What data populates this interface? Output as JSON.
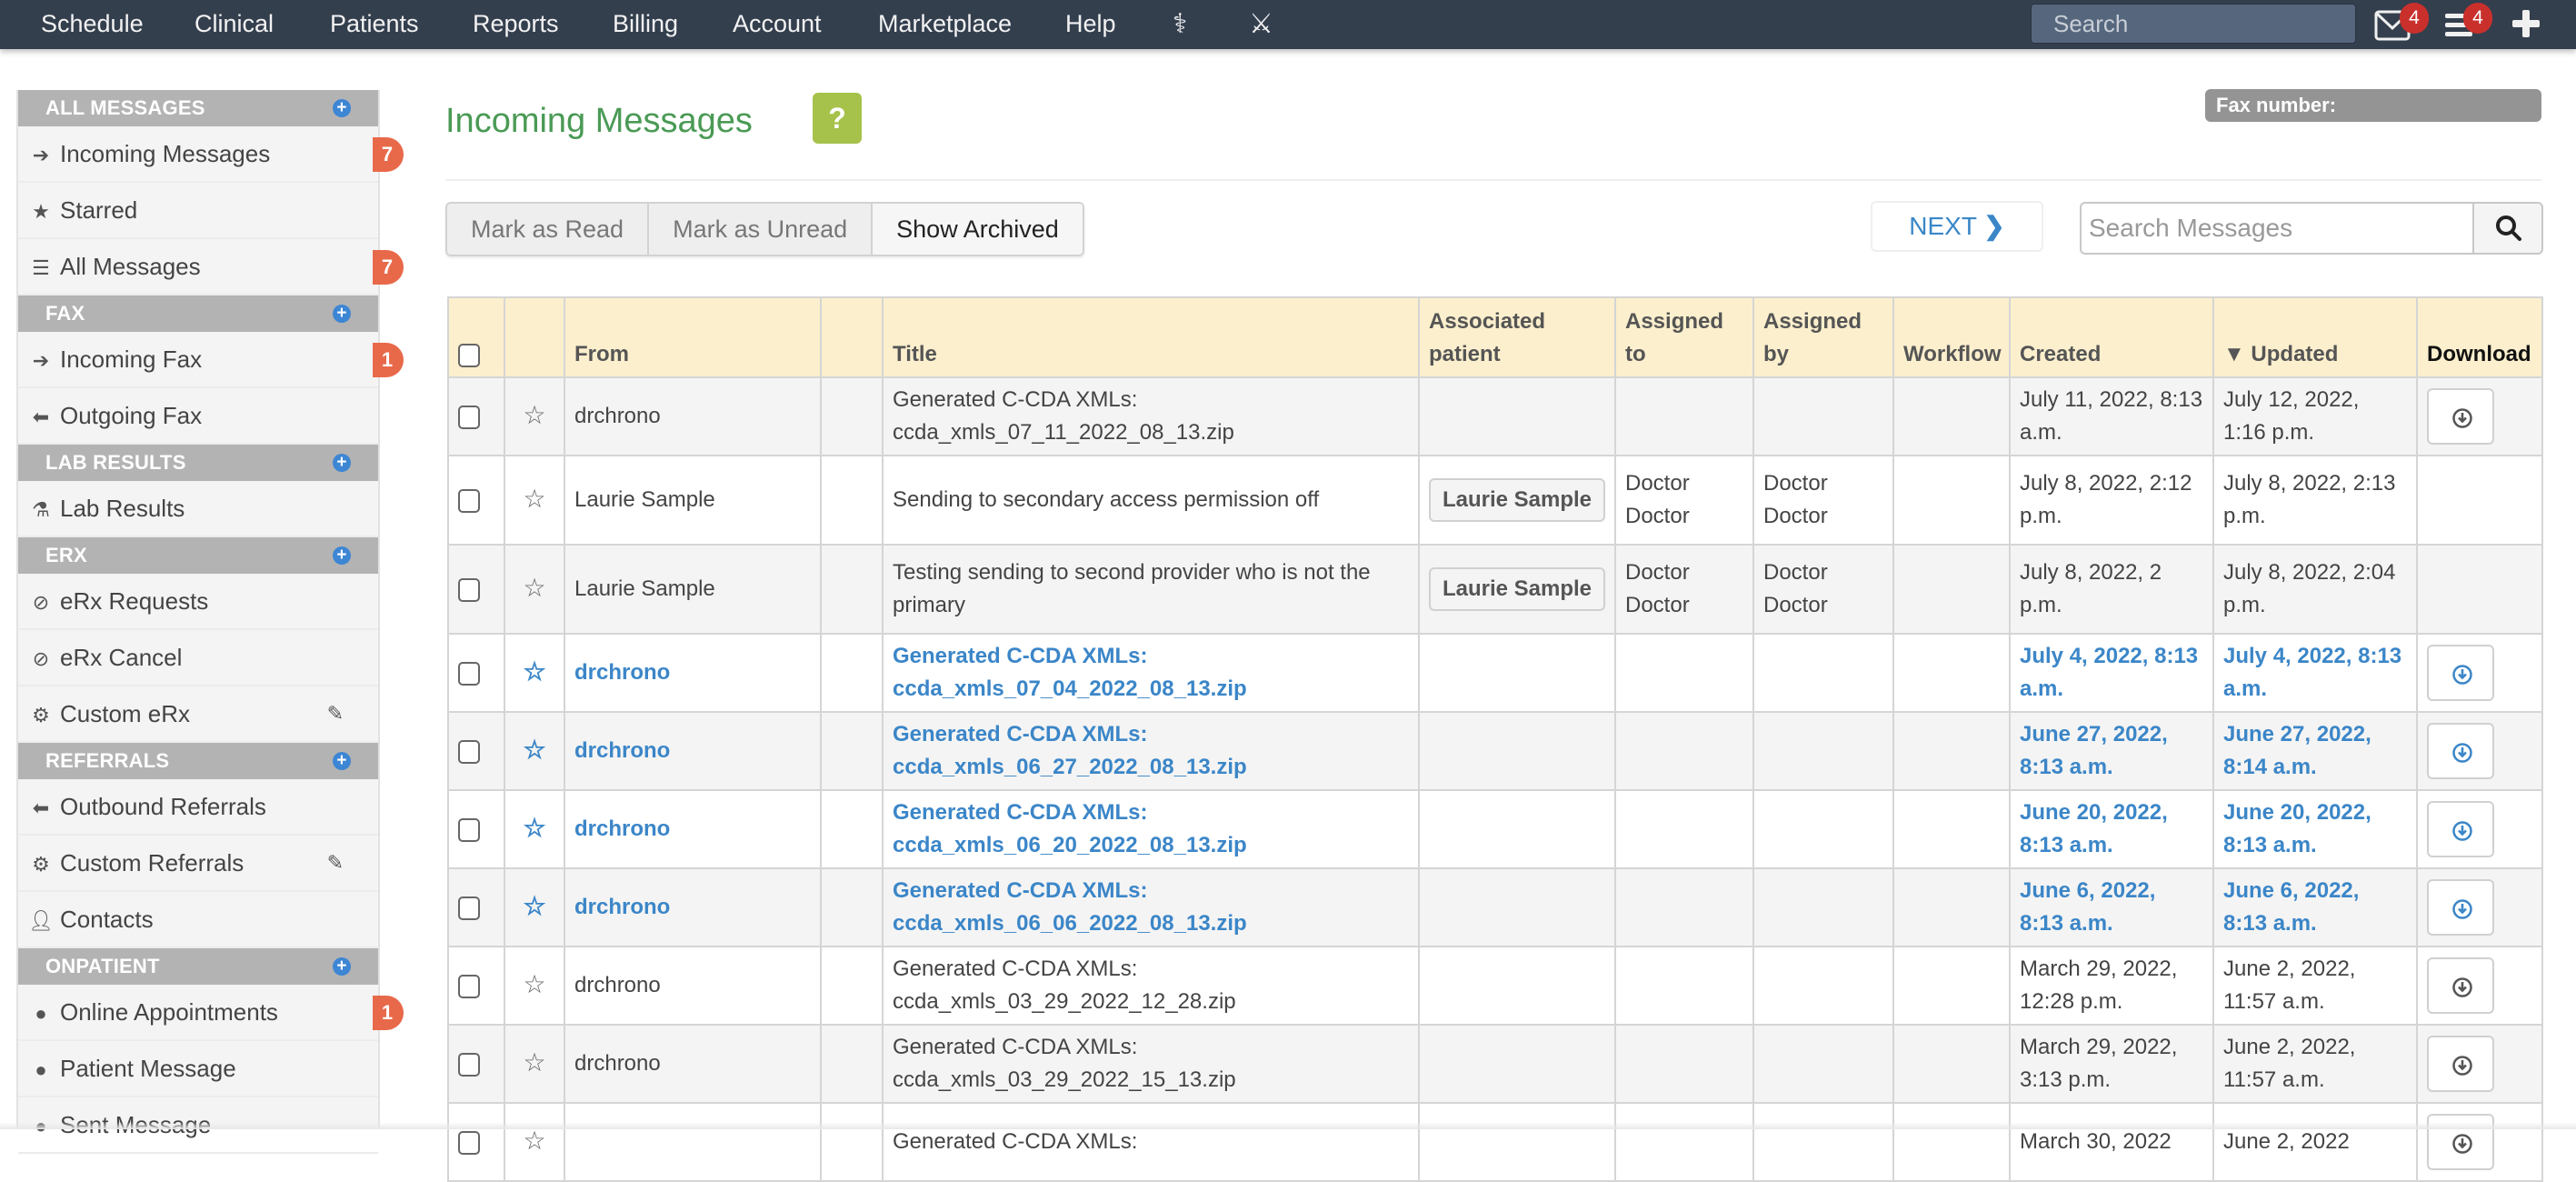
{
  "topnav": {
    "items": [
      "Schedule",
      "Clinical",
      "Patients",
      "Reports",
      "Billing",
      "Account",
      "Marketplace",
      "Help"
    ],
    "search_placeholder": "Search",
    "messages_badge": "4",
    "tasks_badge": "4"
  },
  "sidebar": {
    "sections": [
      {
        "title": "ALL MESSAGES",
        "items": [
          {
            "label": "Incoming Messages",
            "icon": "arrow-right-icon",
            "badge": "7"
          },
          {
            "label": "Starred",
            "icon": "star-icon"
          },
          {
            "label": "All Messages",
            "icon": "list-icon",
            "badge": "7"
          }
        ]
      },
      {
        "title": "FAX",
        "items": [
          {
            "label": "Incoming Fax",
            "icon": "arrow-right-icon",
            "badge": "1"
          },
          {
            "label": "Outgoing Fax",
            "icon": "arrow-left-icon"
          }
        ]
      },
      {
        "title": "LAB RESULTS",
        "items": [
          {
            "label": "Lab Results",
            "icon": "flask-icon"
          }
        ]
      },
      {
        "title": "ERX",
        "items": [
          {
            "label": "eRx Requests",
            "icon": "pill-sync-icon"
          },
          {
            "label": "eRx Cancel",
            "icon": "pill-sync-icon"
          },
          {
            "label": "Custom eRx",
            "icon": "gear-icon",
            "editable": true
          }
        ]
      },
      {
        "title": "REFERRALS",
        "items": [
          {
            "label": "Outbound Referrals",
            "icon": "arrow-left-icon"
          },
          {
            "label": "Custom Referrals",
            "icon": "gear-icon",
            "editable": true
          },
          {
            "label": "Contacts",
            "icon": "user-icon"
          }
        ]
      },
      {
        "title": "ONPATIENT",
        "items": [
          {
            "label": "Online Appointments",
            "icon": "circle-icon",
            "badge": "1"
          },
          {
            "label": "Patient Message",
            "icon": "circle-icon"
          },
          {
            "label": "Sent Message",
            "icon": "circle-icon"
          }
        ]
      }
    ]
  },
  "header": {
    "title": "Incoming Messages",
    "help_label": "?",
    "fax_label": "Fax number:",
    "fax_value": ""
  },
  "toolbar": {
    "mark_read": "Mark as Read",
    "mark_unread": "Mark as Unread",
    "show_archived": "Show Archived",
    "next": "NEXT",
    "search_placeholder": "Search Messages"
  },
  "table": {
    "columns": [
      "",
      "",
      "From",
      "",
      "Title",
      "Associated patient",
      "Assigned to",
      "Assigned by",
      "Workflow",
      "Created",
      "▼ Updated",
      "Download"
    ],
    "rows": [
      {
        "unread": false,
        "from": "drchrono",
        "title": "Generated C-CDA XMLs: ccda_xmls_07_11_2022_08_13.zip",
        "patient": "",
        "assigned_to": "",
        "assigned_by": "",
        "workflow": "",
        "created": "July 11, 2022, 8:13 a.m.",
        "updated": "July 12, 2022, 1:16 p.m.",
        "download": true
      },
      {
        "unread": false,
        "from": "Laurie Sample",
        "title": "Sending to secondary access permission off",
        "patient": "Laurie Sample",
        "assigned_to": "Doctor Doctor",
        "assigned_by": "Doctor Doctor",
        "workflow": "",
        "created": "July 8, 2022, 2:12 p.m.",
        "updated": "July 8, 2022, 2:13 p.m.",
        "download": false
      },
      {
        "unread": false,
        "from": "Laurie Sample",
        "title": "Testing sending to second provider who is not the primary",
        "patient": "Laurie Sample",
        "assigned_to": "Doctor Doctor",
        "assigned_by": "Doctor Doctor",
        "workflow": "",
        "created": "July 8, 2022, 2 p.m.",
        "updated": "July 8, 2022, 2:04 p.m.",
        "download": false
      },
      {
        "unread": true,
        "from": "drchrono",
        "title": "Generated C-CDA XMLs: ccda_xmls_07_04_2022_08_13.zip",
        "patient": "",
        "assigned_to": "",
        "assigned_by": "",
        "workflow": "",
        "created": "July 4, 2022, 8:13 a.m.",
        "updated": "July 4, 2022, 8:13 a.m.",
        "download": true
      },
      {
        "unread": true,
        "from": "drchrono",
        "title": "Generated C-CDA XMLs: ccda_xmls_06_27_2022_08_13.zip",
        "patient": "",
        "assigned_to": "",
        "assigned_by": "",
        "workflow": "",
        "created": "June 27, 2022, 8:13 a.m.",
        "updated": "June 27, 2022, 8:14 a.m.",
        "download": true
      },
      {
        "unread": true,
        "from": "drchrono",
        "title": "Generated C-CDA XMLs: ccda_xmls_06_20_2022_08_13.zip",
        "patient": "",
        "assigned_to": "",
        "assigned_by": "",
        "workflow": "",
        "created": "June 20, 2022, 8:13 a.m.",
        "updated": "June 20, 2022, 8:13 a.m.",
        "download": true
      },
      {
        "unread": true,
        "from": "drchrono",
        "title": "Generated C-CDA XMLs: ccda_xmls_06_06_2022_08_13.zip",
        "patient": "",
        "assigned_to": "",
        "assigned_by": "",
        "workflow": "",
        "created": "June 6, 2022, 8:13 a.m.",
        "updated": "June 6, 2022, 8:13 a.m.",
        "download": true
      },
      {
        "unread": false,
        "from": "drchrono",
        "title": "Generated C-CDA XMLs: ccda_xmls_03_29_2022_12_28.zip",
        "patient": "",
        "assigned_to": "",
        "assigned_by": "",
        "workflow": "",
        "created": "March 29, 2022, 12:28 p.m.",
        "updated": "June 2, 2022, 11:57 a.m.",
        "download": true
      },
      {
        "unread": false,
        "from": "drchrono",
        "title": "Generated C-CDA XMLs: ccda_xmls_03_29_2022_15_13.zip",
        "patient": "",
        "assigned_to": "",
        "assigned_by": "",
        "workflow": "",
        "created": "March 29, 2022, 3:13 p.m.",
        "updated": "June 2, 2022, 11:57 a.m.",
        "download": true
      },
      {
        "unread": false,
        "from": "",
        "title": "Generated C-CDA XMLs:",
        "patient": "",
        "assigned_to": "",
        "assigned_by": "",
        "workflow": "",
        "created": "March 30, 2022",
        "updated": "June 2, 2022",
        "download": true
      }
    ]
  },
  "colors": {
    "nav_bg": "#343f4e",
    "title_green": "#4a9a55",
    "unread_blue": "#3b86c8",
    "badge_orange": "#e8694a",
    "header_yellow": "#fcefcd",
    "help_green": "#a6c24b"
  }
}
